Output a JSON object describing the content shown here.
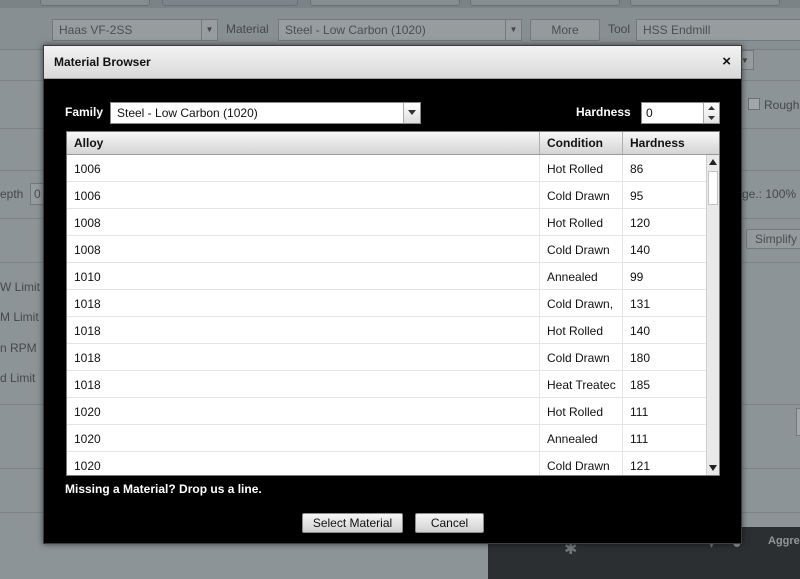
{
  "background": {
    "machine_select": "Haas VF-2SS",
    "material_label": "Material",
    "material_select": "Steel - Low Carbon (1020)",
    "more_button": "More",
    "tool_label": "Tool",
    "tool_select": "HSS Endmill",
    "rough_label": "Rough",
    "depth_label": "epth",
    "depth_value": "0",
    "usage_label": "ge.: 100%",
    "simplify_button": "Simplify",
    "w_limit_label": "W Limit",
    "m_limit_label": "M Limit",
    "min_rpm_label": "n RPM",
    "d_limit_label": "d Limit",
    "aggressive_label": "Aggre"
  },
  "dialog": {
    "title": "Material Browser",
    "close_glyph": "×",
    "family_label": "Family",
    "family_value": "Steel - Low Carbon (1020)",
    "hardness_label": "Hardness",
    "hardness_value": "0",
    "missing_link": "Missing a Material? Drop us a line.",
    "select_button": "Select Material",
    "cancel_button": "Cancel"
  },
  "table": {
    "columns": [
      "Alloy",
      "Condition",
      "Hardness"
    ],
    "rows": [
      {
        "alloy": "1006",
        "condition": "Hot Rolled",
        "hardness": "86"
      },
      {
        "alloy": "1006",
        "condition": "Cold Drawn",
        "hardness": "95"
      },
      {
        "alloy": "1008",
        "condition": "Hot Rolled",
        "hardness": "120"
      },
      {
        "alloy": "1008",
        "condition": "Cold Drawn",
        "hardness": "140"
      },
      {
        "alloy": "1010",
        "condition": "Annealed",
        "hardness": "99"
      },
      {
        "alloy": "1018",
        "condition": "Cold Drawn,",
        "hardness": "131"
      },
      {
        "alloy": "1018",
        "condition": "Hot Rolled",
        "hardness": "140"
      },
      {
        "alloy": "1018",
        "condition": "Cold Drawn",
        "hardness": "180"
      },
      {
        "alloy": "1018",
        "condition": "Heat Treatec",
        "hardness": "185"
      },
      {
        "alloy": "1020",
        "condition": "Hot Rolled",
        "hardness": "111"
      },
      {
        "alloy": "1020",
        "condition": "Annealed",
        "hardness": "111"
      },
      {
        "alloy": "1020",
        "condition": "Cold Drawn",
        "hardness": "121"
      }
    ]
  },
  "icons": {
    "close": "close-icon",
    "dropdown": "chevron-down-icon",
    "spin_up": "spin-up-icon",
    "spin_down": "spin-down-icon",
    "scroll_up": "scroll-up-icon",
    "scroll_down": "scroll-down-icon"
  }
}
